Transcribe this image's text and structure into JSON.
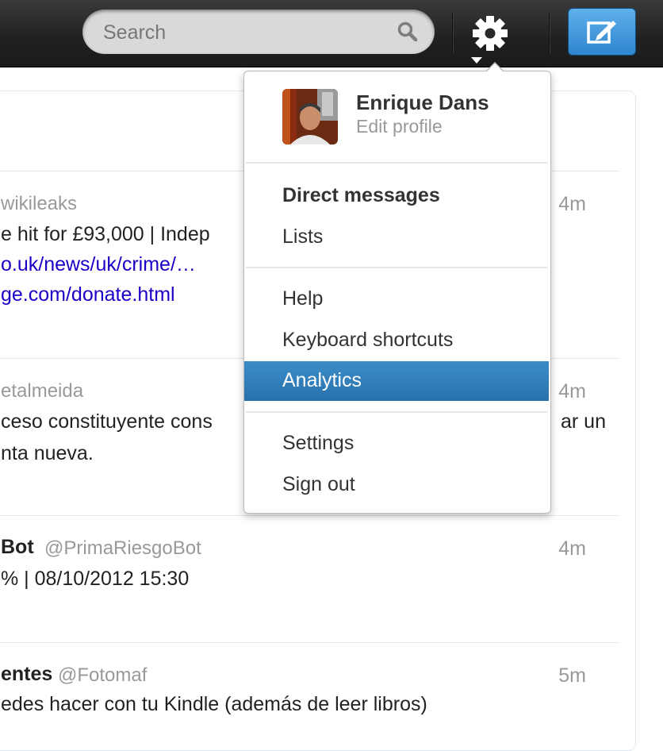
{
  "topbar": {
    "search_placeholder": "Search",
    "icons": [
      "search-icon",
      "gear-icon",
      "compose-tweet-icon"
    ],
    "accent": "#2f86cf"
  },
  "timeline": {
    "tweets": [
      {
        "handle": "wikileaks",
        "time": "4m",
        "lines": [
          "e hit for £93,000 | Indep",
          "o.uk/news/uk/crime/…",
          "ge.com/donate.html"
        ]
      },
      {
        "handle": "etalmeida",
        "time": "4m",
        "lines": [
          "ceso constituyente cons",
          "ar un",
          "nta nueva."
        ]
      },
      {
        "name": "Bot",
        "handle": "@PrimaRiesgoBot",
        "time": "4m",
        "lines": [
          "% | 08/10/2012 15:30"
        ]
      },
      {
        "name": "entes",
        "handle": "@Fotomaf",
        "time": "5m",
        "lines": [
          "edes hacer con tu Kindle (además de leer libros)"
        ]
      }
    ]
  },
  "menu": {
    "profile_name": "Enrique Dans",
    "edit_profile": "Edit profile",
    "items": [
      {
        "label": "Direct messages"
      },
      {
        "label": "Lists"
      },
      {
        "label": "Help"
      },
      {
        "label": "Keyboard shortcuts"
      },
      {
        "label": "Analytics"
      },
      {
        "label": "Settings"
      },
      {
        "label": "Sign out"
      }
    ],
    "highlight_color": "#2b7bb9"
  }
}
